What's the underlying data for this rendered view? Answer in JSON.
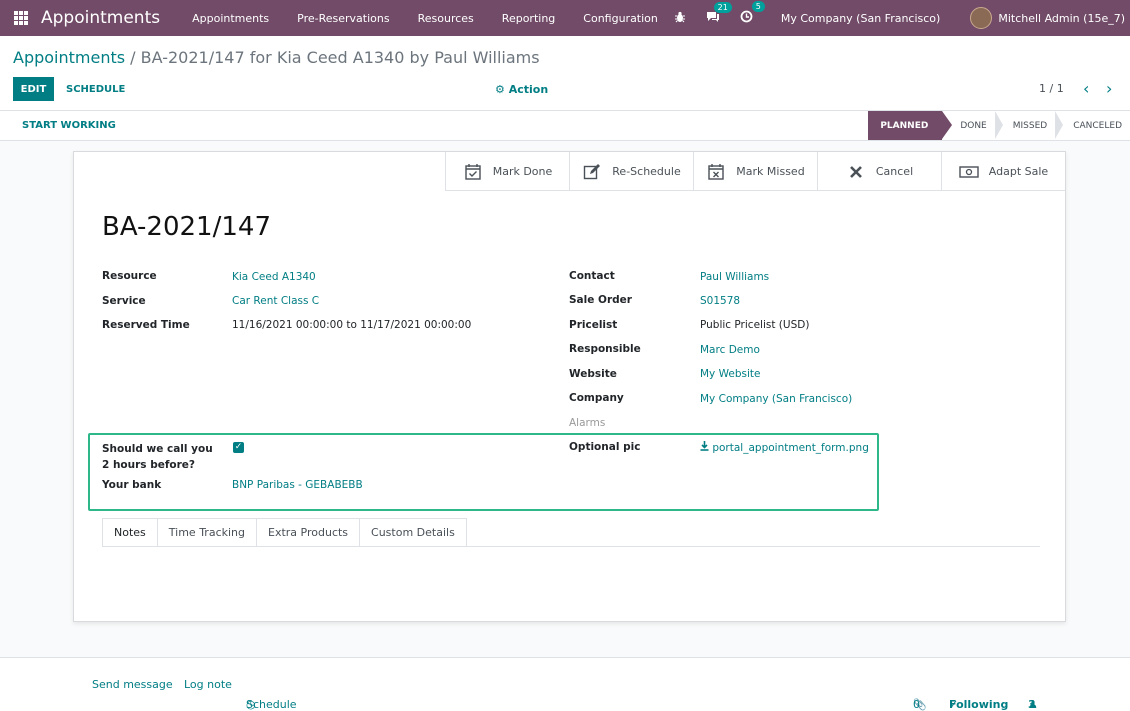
{
  "navbar": {
    "brand": "Appointments",
    "menu": [
      "Appointments",
      "Pre-Reservations",
      "Resources",
      "Reporting",
      "Configuration"
    ],
    "messages_count": "21",
    "activities_count": "5",
    "company": "My Company (San Francisco)",
    "user": "Mitchell Admin (15e_7)"
  },
  "breadcrumb": {
    "parent": "Appointments",
    "separator": " / ",
    "current": "BA-2021/147 for Kia Ceed A1340 by Paul Williams"
  },
  "buttons": {
    "edit": "EDIT",
    "schedule": "SCHEDULE",
    "action": "Action"
  },
  "pager": {
    "value": "1 / 1"
  },
  "statusbar": {
    "start_working": "START WORKING",
    "stages": [
      "PLANNED",
      "DONE",
      "MISSED",
      "CANCELED"
    ],
    "active_stage": "PLANNED"
  },
  "smart_buttons": [
    "Mark Done",
    "Re-Schedule",
    "Mark Missed",
    "Cancel",
    "Adapt Sale"
  ],
  "record": {
    "name": "BA-2021/147",
    "left_fields": [
      {
        "label": "Resource",
        "value": "Kia Ceed A1340"
      },
      {
        "label": "Service",
        "value": "Car Rent Class C"
      },
      {
        "label": "Reserved Time",
        "value": "11/16/2021 00:00:00 to 11/17/2021 00:00:00"
      }
    ],
    "right_fields": [
      {
        "label": "Contact",
        "value": "Paul Williams"
      },
      {
        "label": "Sale Order",
        "value": "S01578"
      },
      {
        "label": "Pricelist",
        "value": "Public Pricelist (USD)"
      },
      {
        "label": "Responsible",
        "value": "Marc Demo"
      },
      {
        "label": "Website",
        "value": "My Website"
      },
      {
        "label": "Company",
        "value": "My Company (San Francisco)"
      },
      {
        "label": "Alarms",
        "value": ""
      }
    ],
    "custom": {
      "call_label": "Should we call you 2 hours before?",
      "call_checked": true,
      "bank_label": "Your bank",
      "bank_value": "BNP Paribas - GEBABEBB",
      "pic_label": "Optional pic",
      "pic_value": "portal_appointment_form.png"
    }
  },
  "tabs": [
    "Notes",
    "Time Tracking",
    "Extra Products",
    "Custom Details"
  ],
  "chatter": {
    "send_message": "Send message",
    "log_note": "Log note",
    "schedule_activity": "Schedule activity",
    "attachments": "0",
    "following": "Following",
    "followers": "3"
  }
}
